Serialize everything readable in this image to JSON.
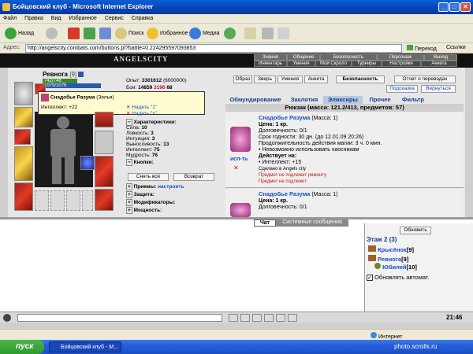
{
  "window": {
    "title": "Бойцовский клуб - Microsoft Internet Explorer"
  },
  "menu": [
    "Файл",
    "Правка",
    "Вид",
    "Избранное",
    "Сервис",
    "Справка"
  ],
  "toolbar": {
    "back": "Назад",
    "search": "Поиск",
    "favorites": "Избранное",
    "media": "Медиа"
  },
  "address": {
    "label": "Адрес:",
    "url": "http://angelscity.combats.com/buttons.pl?battle=0.224295597093853",
    "go": "Переход",
    "links": "Ссылки"
  },
  "game_nav": {
    "logo": "ANGELSCITY",
    "top": [
      "Знания",
      "Общение",
      "Безопасность",
      "Персонаж",
      "Выход"
    ],
    "bottom": [
      "Инвентарь",
      "Умения",
      "Мой Скролл",
      "Турниры",
      "Настройки",
      "Анкета"
    ]
  },
  "character": {
    "name": "Ревнога",
    "level": "[9]",
    "hp": "742/748",
    "mana": "1075/1075",
    "tooltip_title": "Снадобье Разума",
    "tooltip_type": "(Зелья)",
    "tooltip_bonus": "Интеллект: +22",
    "exp_label": "Опыт:",
    "exp": "3301612",
    "exp_next": "(6000000)",
    "battles_label": "Бои:",
    "battles_win": "14859",
    "battles_lose": "3196",
    "battles_draw": "68",
    "links": [
      "Надеть \"1\"",
      "Надеть \"х\""
    ],
    "char_section": "Характеристики:",
    "stats": [
      {
        "label": "Сила:",
        "value": "10"
      },
      {
        "label": "Ловкость:",
        "value": "3"
      },
      {
        "label": "Интуиция:",
        "value": "3"
      },
      {
        "label": "Выносливость:",
        "value": "13"
      },
      {
        "label": "Интеллект:",
        "value": "75"
      },
      {
        "label": "Мудрость:",
        "value": "76"
      }
    ],
    "buttons_section": "Кнопки:",
    "undress": "Снять всё",
    "return": "Возврат",
    "tricks": "Приемы:",
    "tricks_link": "настроить",
    "protection": "Защита:",
    "modifiers": "Модификаторы:",
    "power": "Мощность:"
  },
  "top_buttons": [
    "Образ",
    "Зверь",
    "Умения",
    "Анкета",
    "Безопасность",
    "Отчет о переводах"
  ],
  "hint_link": "Подсказка",
  "back_link": "Вернуться",
  "tabs": [
    "Обмундирование",
    "Заклятия",
    "Эликсиры",
    "Прочее",
    "Фильтр"
  ],
  "backpack": "Рюкзак (масса: 121.2/413, предметов: 57)",
  "items": [
    {
      "name": "Снадобье Разума",
      "mass": "(Масса: 1)",
      "price": "Цена: 1 кр.",
      "durability": "Долговечность: 0/1",
      "expiry": "Срок годности: 30 дн. (до 12.01.09 20:26)",
      "duration": "Продолжительность действия магии: 3 ч. 0 мин.",
      "note": "• Невозможно использовать хаосникам",
      "effects_label": "Действует на:",
      "effect": "• Интеллект: +15",
      "made_in": "Сделано в Angels city",
      "warn1": "Предмет не подлежит ремонту",
      "warn2": "Предмет не подлежит",
      "use_link": "исп-ть"
    },
    {
      "name": "Снадобье Разума",
      "mass": "(Масса: 1)",
      "price": "Цена: 1 кр.",
      "durability": "Долговечность: 0/1"
    }
  ],
  "chat": {
    "tab_chat": "Чат",
    "tab_system": "Системные сообщения",
    "refresh": "Обновить",
    "floor": "Этаж 2 (3)",
    "users": [
      {
        "name": "Крысёнок",
        "level": "[9]"
      },
      {
        "name": "Ревнога",
        "level": "[9]"
      },
      {
        "name": "Юбилей",
        "level": "[10]"
      }
    ],
    "auto_refresh": "Обновлять автомат."
  },
  "clock": "21:46",
  "statusbar": {
    "zone": "Интернет"
  },
  "taskbar": {
    "start": "пуск",
    "item": "Бойцовский клуб - M..."
  },
  "watermark": "photo.scrolls.ru",
  "colors": {
    "link": "#1a4fc0",
    "hp": "#3a8a2a",
    "mana": "#2a5ab0",
    "warn": "#c0181a"
  }
}
